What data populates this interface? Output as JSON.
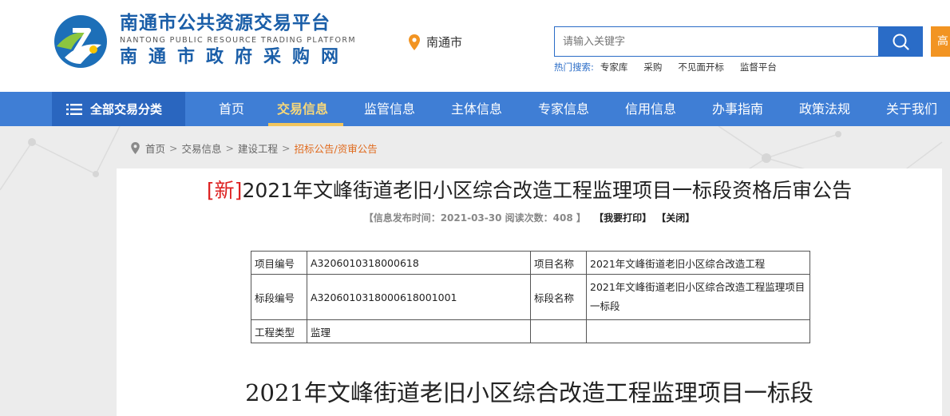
{
  "site": {
    "title": "南通市公共资源交易平台",
    "title_en": "NANTONG PUBLIC RESOURCE TRADING PLATFORM",
    "subtitle": "南通市政府采购网",
    "location": "南通市"
  },
  "search": {
    "placeholder": "请输入关键字",
    "orange_button_label": "高",
    "hot_label": "热门搜索:",
    "hot_items": [
      "专家库",
      "采购",
      "不见面开标",
      "监督平台"
    ]
  },
  "nav": {
    "all_label": "全部交易分类",
    "items": [
      "首页",
      "交易信息",
      "监管信息",
      "主体信息",
      "专家信息",
      "信用信息",
      "办事指南",
      "政策法规",
      "关于我们"
    ],
    "active_index": 1
  },
  "breadcrumb": [
    "首页",
    "交易信息",
    "建设工程",
    "招标公告/资审公告"
  ],
  "article": {
    "new_tag": "[新]",
    "title": "2021年文峰街道老旧小区综合改造工程监理项目一标段资格后审公告",
    "meta": "【信息发布时间：2021-03-30 阅读次数：408 】",
    "print_label": "【我要打印】",
    "close_label": "【关闭】",
    "table": {
      "project_no_label": "项目编号",
      "project_no": "A3206010318000618",
      "project_name_label": "项目名称",
      "project_name": "2021年文峰街道老旧小区综合改造工程",
      "section_no_label": "标段编号",
      "section_no": "A3206010318000618001001",
      "section_name_label": "标段名称",
      "section_name": "2021年文峰街道老旧小区综合改造工程监理项目一标段",
      "type_label": "工程类型",
      "type": "监理"
    },
    "body_title": "2021年文峰街道老旧小区综合改造工程监理项目一标段"
  },
  "colors": {
    "brand_blue": "#1a5ea8",
    "nav_blue": "#3f7ed5",
    "nav_active": "#f7d87a",
    "accent_orange": "#f29422",
    "new_red": "#d22222"
  }
}
